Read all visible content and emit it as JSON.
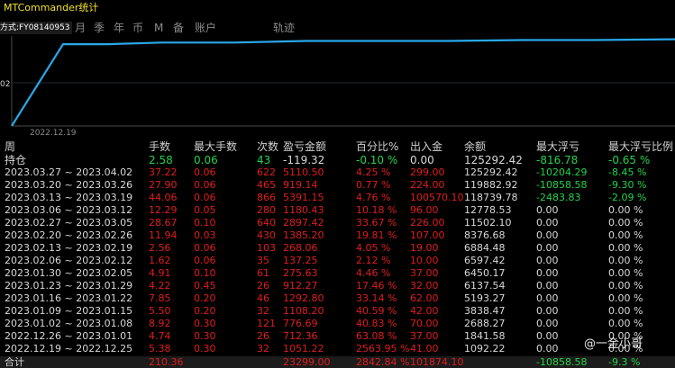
{
  "window": {
    "title": "MTCommander统计"
  },
  "tabs": {
    "mode_label": "方式:FY08140953",
    "items": [
      "月",
      "季",
      "年",
      "币",
      "M",
      "备",
      "账户",
      "轨迹"
    ]
  },
  "chart": {
    "y_tick": "02",
    "x_tick": "2022.12.19",
    "line_color": "#29a8ea",
    "grid_color": "#1f2a35"
  },
  "chart_data": {
    "type": "line",
    "x": [
      "2022.12.19"
    ],
    "y_tick_labels": [
      "02"
    ],
    "series": [
      {
        "values": [
          0,
          100,
          100,
          102,
          102,
          104,
          104,
          104,
          105,
          105,
          106
        ]
      }
    ]
  },
  "table": {
    "headers": [
      "周",
      "手数",
      "最大手数",
      "次数",
      "盈亏金额",
      "百分比%",
      "出入金",
      "余额",
      "最大浮亏",
      "最大浮亏比例"
    ],
    "position": {
      "label": "持仓",
      "cells": [
        "2.58",
        "0.06",
        "43",
        "-119.32",
        "-0.10 %",
        "0.00",
        "125292.42",
        "-816.78",
        "-0.65 %"
      ]
    },
    "rows": [
      [
        "2023.03.27 ~ 2023.04.02",
        "37.22",
        "0.06",
        "622",
        "5110.50",
        "4.25 %",
        "299.00",
        "125292.42",
        "-10204.29",
        "-8.45 %"
      ],
      [
        "2023.03.20 ~ 2023.03.26",
        "27.90",
        "0.06",
        "465",
        "919.14",
        "0.77 %",
        "224.00",
        "119882.92",
        "-10858.58",
        "-9.30 %"
      ],
      [
        "2023.03.13 ~ 2023.03.19",
        "44.06",
        "0.06",
        "866",
        "5391.15",
        "4.76 %",
        "100570.10",
        "118739.78",
        "-2483.83",
        "-2.09 %"
      ],
      [
        "2023.03.06 ~ 2023.03.12",
        "12.29",
        "0.05",
        "280",
        "1180.43",
        "10.18 %",
        "96.00",
        "12778.53",
        "0.00",
        "0.00 %"
      ],
      [
        "2023.02.27 ~ 2023.03.05",
        "28.67",
        "0.10",
        "640",
        "2897.42",
        "33.67 %",
        "226.00",
        "11502.10",
        "0.00",
        "0.00 %"
      ],
      [
        "2023.02.20 ~ 2023.02.26",
        "11.94",
        "0.03",
        "430",
        "1385.20",
        "19.81 %",
        "107.00",
        "8376.68",
        "0.00",
        "0.00 %"
      ],
      [
        "2023.02.13 ~ 2023.02.19",
        "2.56",
        "0.06",
        "103",
        "268.06",
        "4.05 %",
        "19.00",
        "6884.48",
        "0.00",
        "0.00 %"
      ],
      [
        "2023.02.06 ~ 2023.02.12",
        "1.62",
        "0.06",
        "35",
        "137.25",
        "2.12 %",
        "10.00",
        "6597.42",
        "0.00",
        "0.00 %"
      ],
      [
        "2023.01.30 ~ 2023.02.05",
        "4.91",
        "0.10",
        "61",
        "275.63",
        "4.46 %",
        "37.00",
        "6450.17",
        "0.00",
        "0.00 %"
      ],
      [
        "2023.01.23 ~ 2023.01.29",
        "4.22",
        "0.45",
        "26",
        "912.27",
        "17.46 %",
        "32.00",
        "6137.54",
        "0.00",
        "0.00 %"
      ],
      [
        "2023.01.16 ~ 2023.01.22",
        "7.85",
        "0.20",
        "46",
        "1292.80",
        "33.14 %",
        "62.00",
        "5193.27",
        "0.00",
        "0.00 %"
      ],
      [
        "2023.01.09 ~ 2023.01.15",
        "5.50",
        "0.20",
        "32",
        "1108.20",
        "40.59 %",
        "42.00",
        "3838.47",
        "0.00",
        "0.00 %"
      ],
      [
        "2023.01.02 ~ 2023.01.08",
        "8.92",
        "0.30",
        "121",
        "776.69",
        "40.83 %",
        "70.00",
        "2688.27",
        "0.00",
        "0.00 %"
      ],
      [
        "2022.12.26 ~ 2023.01.01",
        "4.74",
        "0.30",
        "26",
        "712.36",
        "63.08 %",
        "37.00",
        "1841.58",
        "0.00",
        "0.00 %"
      ],
      [
        "2022.12.19 ~ 2022.12.25",
        "5.38",
        "0.30",
        "32",
        "1051.22",
        "2563.95 %",
        "41.00",
        "1092.22",
        "0.00",
        "0.00 %"
      ]
    ],
    "total": {
      "label": "合计",
      "cells": [
        "210.36",
        "",
        "",
        "23299.00",
        "2842.84 %",
        "101874.10",
        "",
        "-10858.58",
        "-9.3 %"
      ]
    }
  },
  "watermark": {
    "text": "@一金小哥"
  }
}
